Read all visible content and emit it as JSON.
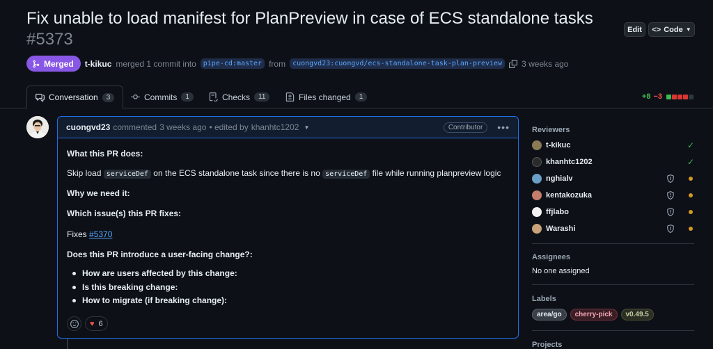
{
  "pr": {
    "title": "Fix unable to load manifest for PlanPreview in case of ECS standalone tasks",
    "number": "#5373",
    "status": "Merged",
    "author": "t-kikuc",
    "merge_text": "merged 1 commit into",
    "base_branch": "pipe-cd:master",
    "from_text": "from",
    "head_branch": "cuongvd23:cuongvd/ecs-standalone-task-plan-preview",
    "time": "3 weeks ago",
    "edit_label": "Edit",
    "code_label": "Code"
  },
  "tabs": [
    {
      "label": "Conversation",
      "count": "3",
      "icon": "comment-discussion-icon"
    },
    {
      "label": "Commits",
      "count": "1",
      "icon": "git-commit-icon"
    },
    {
      "label": "Checks",
      "count": "11",
      "icon": "checklist-icon"
    },
    {
      "label": "Files changed",
      "count": "1",
      "icon": "file-diff-icon"
    }
  ],
  "diffstat": {
    "additions": "+8",
    "deletions": "−3",
    "colors": [
      "#3fb950",
      "#da3633",
      "#da3633",
      "#da3633",
      "#30363d"
    ]
  },
  "comment": {
    "author": "cuongvd23",
    "action": "commented",
    "time": "3 weeks ago",
    "edited": "• edited by",
    "editor": "khanhtc1202",
    "badge": "Contributor",
    "h1": "What this PR does:",
    "p1_a": "Skip load",
    "p1_code1": "serviceDef",
    "p1_b": "on the ECS standalone task since there is no",
    "p1_code2": "serviceDef",
    "p1_c": "file while running planpreview logic",
    "h2": "Why we need it:",
    "h3": "Which issue(s) this PR fixes:",
    "fixes_label": "Fixes",
    "fixes_link": "#5370",
    "h4": "Does this PR introduce a user-facing change?:",
    "bullets": [
      "How are users affected by this change:",
      "Is this breaking change:",
      "How to migrate (if breaking change):"
    ],
    "heart_count": "6"
  },
  "sidebar": {
    "reviewers_title": "Reviewers",
    "reviewers": [
      {
        "name": "t-kikuc",
        "state": "approved",
        "color": "#8a7a55"
      },
      {
        "name": "khanhtc1202",
        "state": "approved",
        "color": "#2b2b2b"
      },
      {
        "name": "nghialv",
        "state": "pending",
        "color": "#6aa0c8"
      },
      {
        "name": "kentakozuka",
        "state": "pending",
        "color": "#c47e6b"
      },
      {
        "name": "ffjlabo",
        "state": "pending",
        "color": "#f2f2f2"
      },
      {
        "name": "Warashi",
        "state": "pending",
        "color": "#c9a27a"
      }
    ],
    "assignees_title": "Assignees",
    "assignees_value": "No one assigned",
    "labels_title": "Labels",
    "labels": [
      {
        "name": "area/go",
        "bg": "#3a3f47",
        "border": "#5c636d",
        "fg": "#e6edf3"
      },
      {
        "name": "cherry-pick",
        "bg": "#3b1e25",
        "border": "#7a2f3c",
        "fg": "#f4a6b4"
      },
      {
        "name": "v0.49.5",
        "bg": "#2b2f23",
        "border": "#4b5138",
        "fg": "#c6cfa8"
      }
    ],
    "projects_title": "Projects"
  }
}
